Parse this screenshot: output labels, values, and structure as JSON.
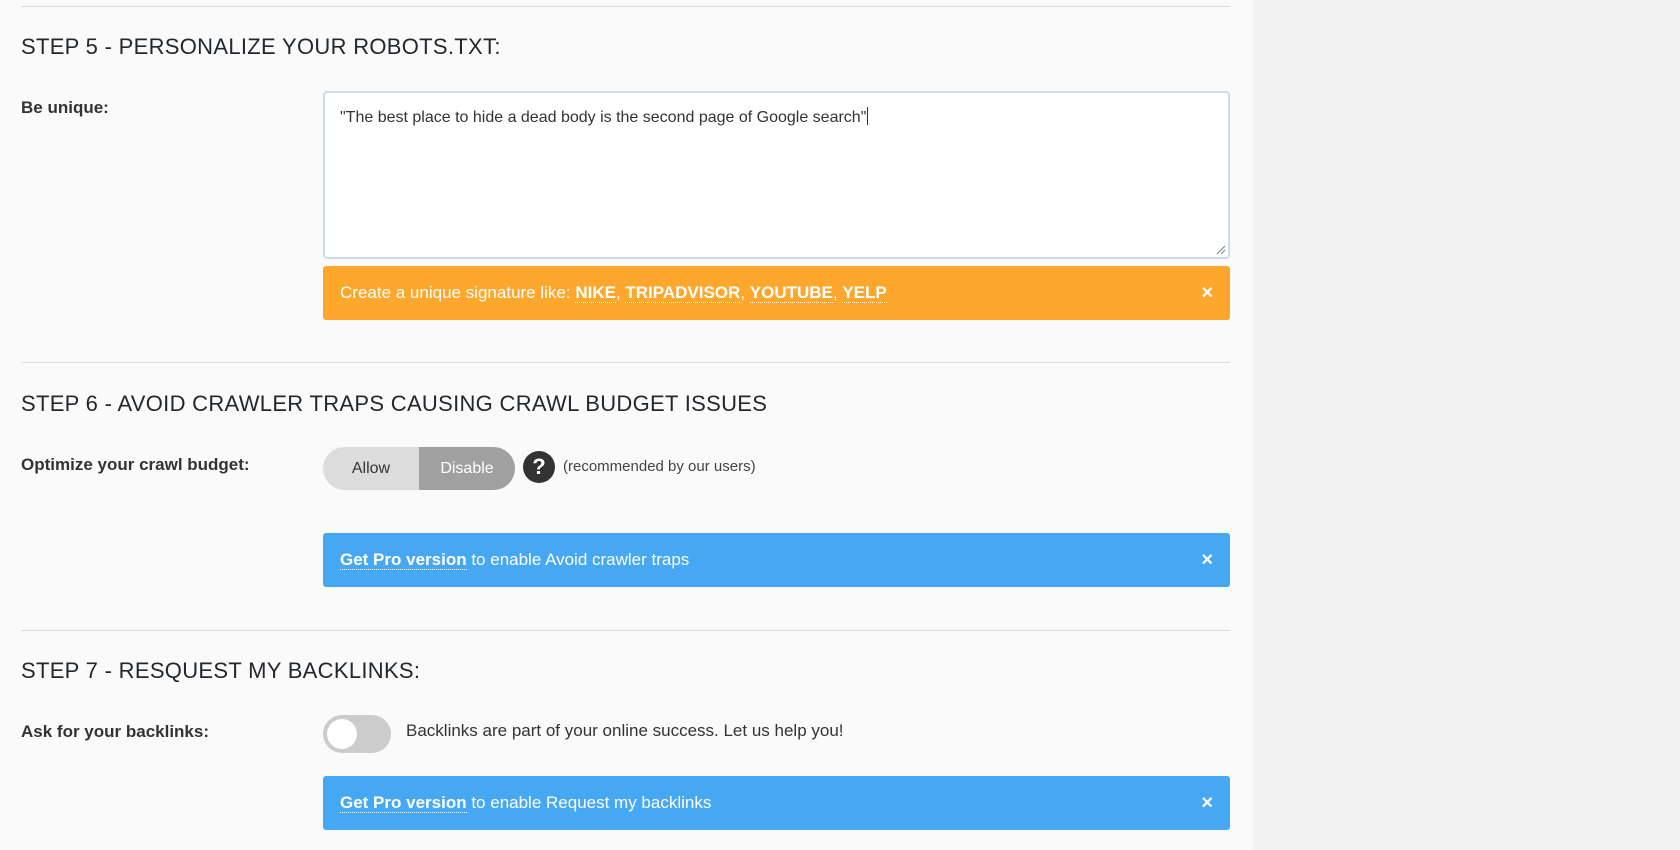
{
  "step5": {
    "heading": "STEP 5 - PERSONALIZE YOUR ROBOTS.TXT:",
    "label": "Be unique:",
    "textarea_value": "\"The best place to hide a dead body is the second page of Google search\"",
    "notice": {
      "prefix": "Create a unique signature like: ",
      "links": [
        "NIKE",
        "TRIPADVISOR",
        "YOUTUBE",
        "YELP"
      ],
      "separator": ", ",
      "close": "×"
    }
  },
  "step6": {
    "heading": "STEP 6 - AVOID CRAWLER TRAPS CAUSING CRAWL BUDGET ISSUES",
    "label": "Optimize your crawl budget:",
    "options": [
      "Allow",
      "Disable"
    ],
    "selected": "Disable",
    "help": "?",
    "recommendation": "(recommended by our users)",
    "notice": {
      "link": "Get Pro version",
      "text": " to enable Avoid crawler traps",
      "close": "×"
    }
  },
  "step7": {
    "heading": "STEP 7 - RESQUEST MY BACKLINKS:",
    "label": "Ask for your backlinks:",
    "toggle_on": false,
    "toggle_text": "Backlinks are part of your online success. Let us help you!",
    "notice": {
      "link": "Get Pro version",
      "text": " to enable Request my backlinks",
      "close": "×"
    }
  },
  "colors": {
    "warning": "#fea72d",
    "info": "#46a7f3",
    "segment_active": "#a0a0a0",
    "segment_inactive": "#dcdcdc"
  }
}
